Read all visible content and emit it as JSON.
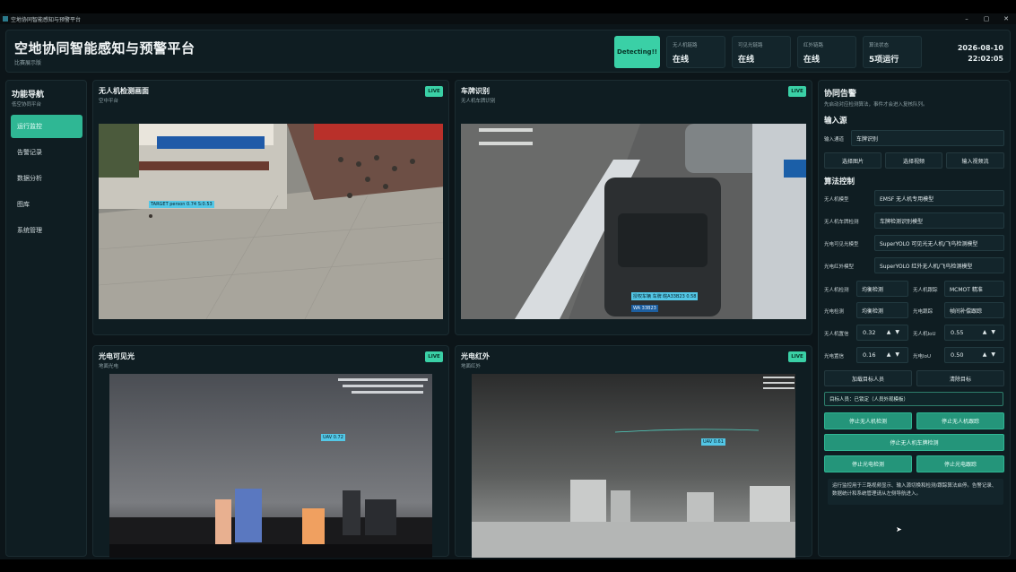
{
  "window": {
    "title": "空地协同智能感知与预警平台",
    "controls": [
      "–",
      "▢",
      "✕"
    ]
  },
  "header": {
    "title": "空地协同智能感知与预警平台",
    "subtitle": "比赛展示版",
    "detect_button": "Detecting!!",
    "stats": [
      {
        "label": "无人机链路",
        "value": "在线"
      },
      {
        "label": "可见光链路",
        "value": "在线"
      },
      {
        "label": "红外链路",
        "value": "在线"
      },
      {
        "label": "算法状态",
        "value": "5项运行"
      }
    ],
    "date": "2026-08-10",
    "time": "22:02:05"
  },
  "nav": {
    "title": "功能导航",
    "subtitle": "低空协同平台",
    "items": [
      "运行监控",
      "告警记录",
      "数据分析",
      "图库",
      "系统管理"
    ],
    "active": "运行监控"
  },
  "panels": [
    {
      "title": "无人机检测画面",
      "subtitle": "空中平台",
      "badge": "LIVE",
      "tags": [
        "TARGET person 0.74 S:0.53"
      ]
    },
    {
      "title": "车牌识别",
      "subtitle": "无人机车牌识别",
      "badge": "LIVE",
      "tags": [
        "授权车辆 车牌 皖A33B23 0.58",
        "WA 33B23"
      ]
    },
    {
      "title": "光电可见光",
      "subtitle": "地面光电",
      "badge": "LIVE",
      "tags": [
        "UAV 0.72"
      ]
    },
    {
      "title": "光电红外",
      "subtitle": "地面红外",
      "badge": "LIVE",
      "tags": [
        "UAV 0.61"
      ]
    }
  ],
  "right": {
    "title": "协同告警",
    "subtitle": "先启动对应检测算法，事件才会进入复核队列。",
    "input_section": "输入源",
    "input_channel_label": "输入通道",
    "input_channel_value": "车牌识别",
    "input_buttons": [
      "选择图片",
      "选择视频",
      "输入视频流"
    ],
    "algo_section": "算法控制",
    "models": [
      {
        "label": "无人机模型",
        "value": "EMSF 无人机专用模型"
      },
      {
        "label": "无人机车牌检测",
        "value": "车牌检测识别模型"
      },
      {
        "label": "光电可见光模型",
        "value": "SuperYOLO 可见光无人机/飞鸟检测模型"
      },
      {
        "label": "光电红外模型",
        "value": "SuperYOLO 红外无人机/飞鸟检测模型"
      }
    ],
    "modes": [
      {
        "label": "无人机检测",
        "value": "均衡检测",
        "label2": "无人机跟踪",
        "value2": "MCMOT 精准"
      },
      {
        "label": "光电检测",
        "value": "均衡检测",
        "label2": "光电跟踪",
        "value2": "帧间补偿跟踪"
      }
    ],
    "thresholds": [
      {
        "label": "无人机置信",
        "value": "0.32",
        "label2": "无人机IoU",
        "value2": "0.55"
      },
      {
        "label": "光电置信",
        "value": "0.16",
        "label2": "光电IoU",
        "value2": "0.50"
      }
    ],
    "target_buttons": [
      "加载目标人员",
      "清除目标"
    ],
    "notice": "目标人员：已锁定（人员外观模板）",
    "action_buttons": [
      "停止无人机检测",
      "停止无人机跟踪",
      "停止无人机车牌检测",
      "停止光电检测",
      "停止光电跟踪"
    ],
    "note": "运行监控用于三路视频显示、输入源切换和检测/跟踪算法启停。告警记录、数据统计和系统管理请从左侧导航进入。"
  },
  "colors": {
    "accent": "#3ad0a6",
    "accent_dark": "#24957a",
    "panel": "#0f1d22",
    "field": "#13252b"
  }
}
